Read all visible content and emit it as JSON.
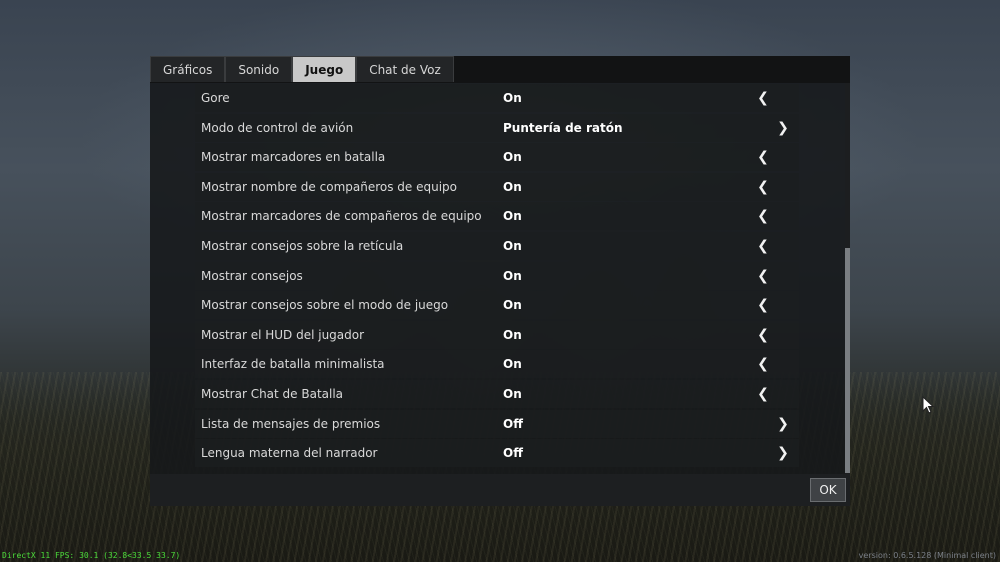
{
  "tabs": [
    {
      "label": "Gráficos",
      "active": false
    },
    {
      "label": "Sonido",
      "active": false
    },
    {
      "label": "Juego",
      "active": true
    },
    {
      "label": "Chat de Voz",
      "active": false
    }
  ],
  "settings": [
    {
      "label": "Gore",
      "value": "On",
      "arrow": "left"
    },
    {
      "label": "Modo de control de avión",
      "value": "Puntería de ratón",
      "arrow": "right"
    },
    {
      "label": "Mostrar marcadores en batalla",
      "value": "On",
      "arrow": "left"
    },
    {
      "label": "Mostrar nombre de compañeros de equipo",
      "value": "On",
      "arrow": "left"
    },
    {
      "label": "Mostrar marcadores de compañeros de equipo",
      "value": "On",
      "arrow": "left"
    },
    {
      "label": "Mostrar consejos sobre la retícula",
      "value": "On",
      "arrow": "left"
    },
    {
      "label": "Mostrar consejos",
      "value": "On",
      "arrow": "left"
    },
    {
      "label": "Mostrar consejos sobre el modo de juego",
      "value": "On",
      "arrow": "left"
    },
    {
      "label": "Mostrar el HUD del jugador",
      "value": "On",
      "arrow": "left"
    },
    {
      "label": "Interfaz de batalla minimalista",
      "value": "On",
      "arrow": "left"
    },
    {
      "label": "Mostrar Chat de Batalla",
      "value": "On",
      "arrow": "left"
    },
    {
      "label": "Lista de mensajes de premios",
      "value": "Off",
      "arrow": "right"
    },
    {
      "label": "Lengua materna del narrador",
      "value": "Off",
      "arrow": "right"
    }
  ],
  "ok_label": "OK",
  "debug_text": "DirectX 11 FPS: 30.1 (32.8<33.5 33.7)",
  "version_text": "version: 0.6.5.128 (Minimal client)",
  "icons": {
    "left": "chevron-left-icon",
    "right": "chevron-right-icon",
    "cursor": "mouse-cursor-icon"
  }
}
